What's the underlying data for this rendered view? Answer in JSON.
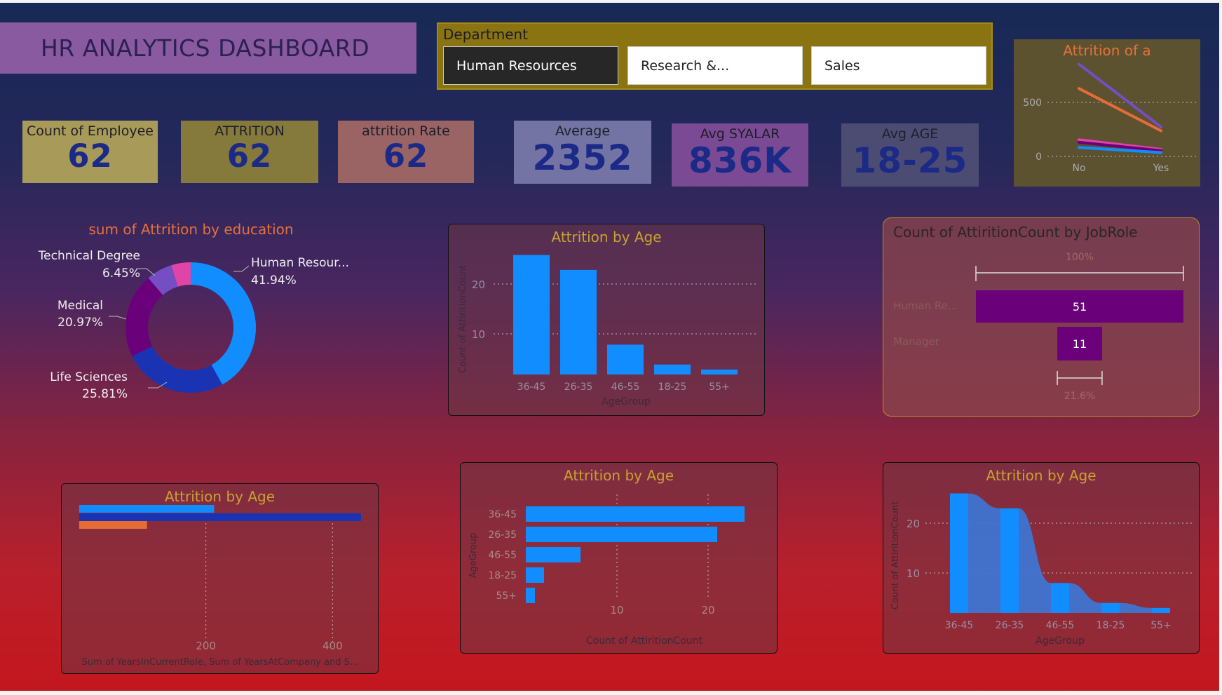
{
  "dashboard": {
    "title": "HR ANALYTICS  DASHBOARD"
  },
  "department_slicer": {
    "label": "Department",
    "options": [
      {
        "label": "Human Resources",
        "selected": true
      },
      {
        "label": "Research &...",
        "selected": false
      },
      {
        "label": "Sales",
        "selected": false
      }
    ]
  },
  "kpis": [
    {
      "label": "Count of Employee",
      "value": "62",
      "bg": "#a89a58"
    },
    {
      "label": "ATTRITION",
      "value": "62",
      "bg": "#857a3c"
    },
    {
      "label": "attrition Rate",
      "value": "62",
      "bg": "#9a6464"
    },
    {
      "label": "Average",
      "value": "2352",
      "bg": "#7474a4"
    },
    {
      "label": "Avg SYALAR",
      "value": "836K",
      "bg": "#7a4a94"
    },
    {
      "label": "Avg AGE",
      "value": "18-25",
      "bg": "#4c4c72"
    }
  ],
  "colors": {
    "primary_blue": "#118dff",
    "dark_blue": "#1a33b3",
    "orange": "#e66c37",
    "purple": "#6b007b",
    "magenta": "#e044a7",
    "title_gold": "#c9a232",
    "title_orange": "#e8703a"
  },
  "chart_data": [
    {
      "id": "attrition-mini-line",
      "type": "line",
      "title": "Attrition of a",
      "x": [
        "No",
        "Yes"
      ],
      "yticks": [
        "500",
        "0"
      ],
      "ylim": [
        0,
        750
      ],
      "series": [
        {
          "color": "#744ec2",
          "values": [
            720,
            230
          ]
        },
        {
          "color": "#e66c37",
          "values": [
            530,
            200
          ]
        },
        {
          "color": "#e044a7",
          "values": [
            130,
            55
          ]
        },
        {
          "color": "#6b007b",
          "values": [
            110,
            45
          ]
        },
        {
          "color": "#118dff",
          "values": [
            70,
            30
          ]
        }
      ]
    },
    {
      "id": "education-donut",
      "type": "pie",
      "title": "sum of Attrition by education",
      "slices": [
        {
          "label": "Human Resour...",
          "pct": "41.94%",
          "value": 41.94,
          "color": "#118dff"
        },
        {
          "label": "Life Sciences",
          "pct": "25.81%",
          "value": 25.81,
          "color": "#1a33b3"
        },
        {
          "label": "Medical",
          "pct": "20.97%",
          "value": 20.97,
          "color": "#6b007b"
        },
        {
          "label": "Technical Degree",
          "pct": "6.45%",
          "value": 6.45,
          "color": "#744ec2"
        },
        {
          "label": "",
          "pct": "",
          "value": 4.83,
          "color": "#e044a7"
        }
      ]
    },
    {
      "id": "age-column",
      "type": "bar",
      "title": "Attrition by Age",
      "categories": [
        "36-45",
        "26-35",
        "46-55",
        "18-25",
        "55+"
      ],
      "values": [
        24,
        21,
        6,
        2,
        1
      ],
      "xlabel": "AgeGroup",
      "ylabel": "Count of AttiritionCount",
      "yticks": [
        "20",
        "10"
      ],
      "ylim": [
        0,
        25
      ]
    },
    {
      "id": "jobrole-funnel",
      "type": "bar",
      "title": "Count of AttiritionCount by JobRole",
      "top_label": "100%",
      "bottom_label": "21.6%",
      "categories": [
        "Human Re...",
        "Manager"
      ],
      "values": [
        51,
        11
      ],
      "value_labels": [
        "51",
        "11"
      ]
    },
    {
      "id": "years-bar",
      "type": "bar",
      "title": "Attrition by Age",
      "xlabel": "Sum of YearsInCurrentRole, Sum of YearsAtCompany and S...",
      "xticks": [
        "200",
        "400"
      ],
      "xlim": [
        0,
        445
      ],
      "series": [
        {
          "color": "#118dff",
          "values": [
            213
          ]
        },
        {
          "color": "#1a33b3",
          "values": [
            445
          ]
        },
        {
          "color": "#e66c37",
          "values": [
            107
          ]
        }
      ]
    },
    {
      "id": "age-horizontal-bar",
      "type": "bar",
      "title": "Attrition by Age",
      "categories": [
        "36-45",
        "26-35",
        "46-55",
        "18-25",
        "55+"
      ],
      "values": [
        24,
        21,
        6,
        2,
        1
      ],
      "xlabel": "Count of AttiritionCount",
      "ylabel": "AgeGroup",
      "xticks": [
        "10",
        "20"
      ],
      "xlim": [
        0,
        24
      ]
    },
    {
      "id": "age-ribbon",
      "type": "area",
      "title": "Attrition by Age",
      "categories": [
        "36-45",
        "26-35",
        "46-55",
        "18-25",
        "55+"
      ],
      "values": [
        24,
        21,
        6,
        2,
        1
      ],
      "xlabel": "AgeGroup",
      "ylabel": "Count of AttiritionCount",
      "yticks": [
        "20",
        "10"
      ],
      "ylim": [
        0,
        25
      ]
    }
  ]
}
